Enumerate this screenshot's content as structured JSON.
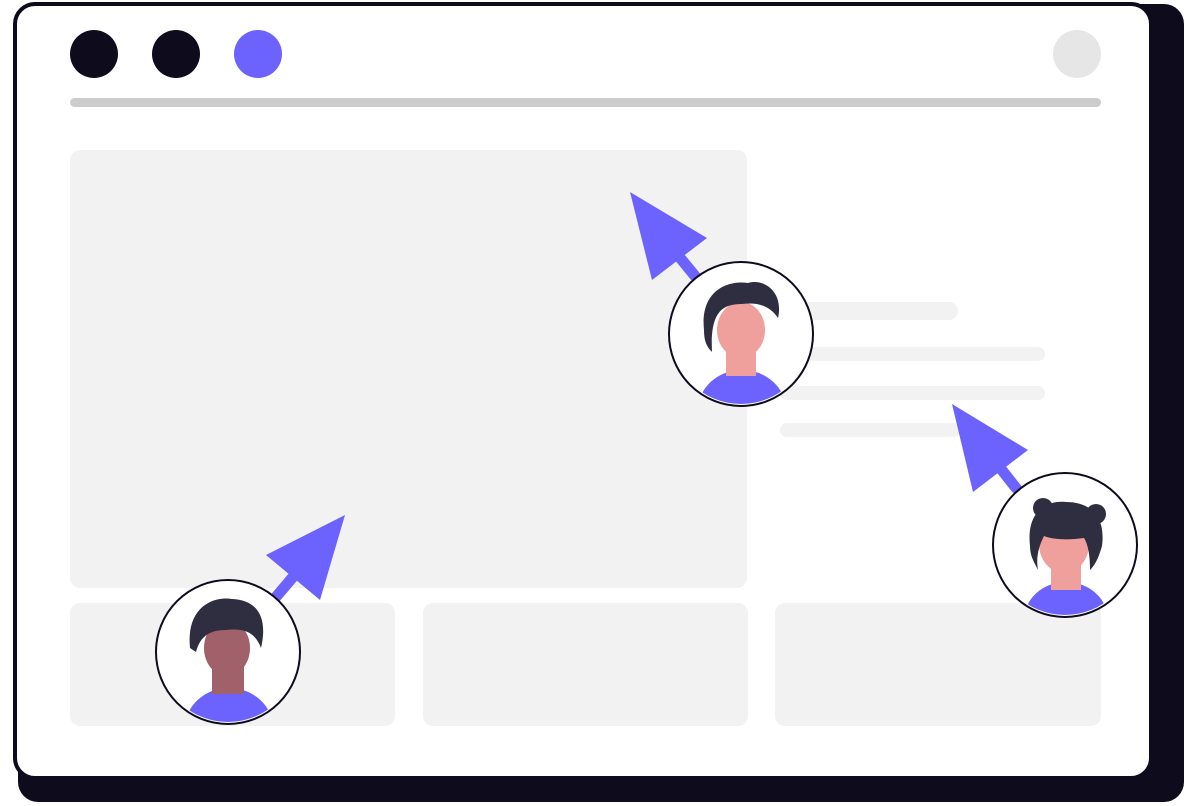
{
  "colors": {
    "shadow": "#0d0b1c",
    "window_bg": "#ffffff",
    "outline": "#0d0b1c",
    "dot_dark": "#0d0b1c",
    "accent": "#6c63ff",
    "profile_circle": "#e6e6e6",
    "divider": "#cccccc",
    "panel": "#f2f2f2",
    "skin_light": "#f0a09c",
    "skin_dark": "#a0616a",
    "hair": "#2f2e41"
  },
  "window_controls": [
    {
      "name": "dot-dark-1",
      "color": "#0d0b1c"
    },
    {
      "name": "dot-dark-2",
      "color": "#0d0b1c"
    },
    {
      "name": "dot-accent",
      "color": "#6c63ff"
    }
  ],
  "icons": {
    "profile": "avatar-placeholder-icon",
    "cursor": "pointer-arrow-icon",
    "user": "user-avatar-icon"
  },
  "collaborators": [
    {
      "name": "collaborator-man-dark-skin",
      "skin": "#a0616a",
      "hair": "#2f2e41",
      "shirt": "#6c63ff"
    },
    {
      "name": "collaborator-man-light-skin",
      "skin": "#f0a09c",
      "hair": "#2f2e41",
      "shirt": "#6c63ff"
    },
    {
      "name": "collaborator-woman-buns",
      "skin": "#f0a09c",
      "hair": "#2f2e41",
      "shirt": "#6c63ff"
    }
  ]
}
